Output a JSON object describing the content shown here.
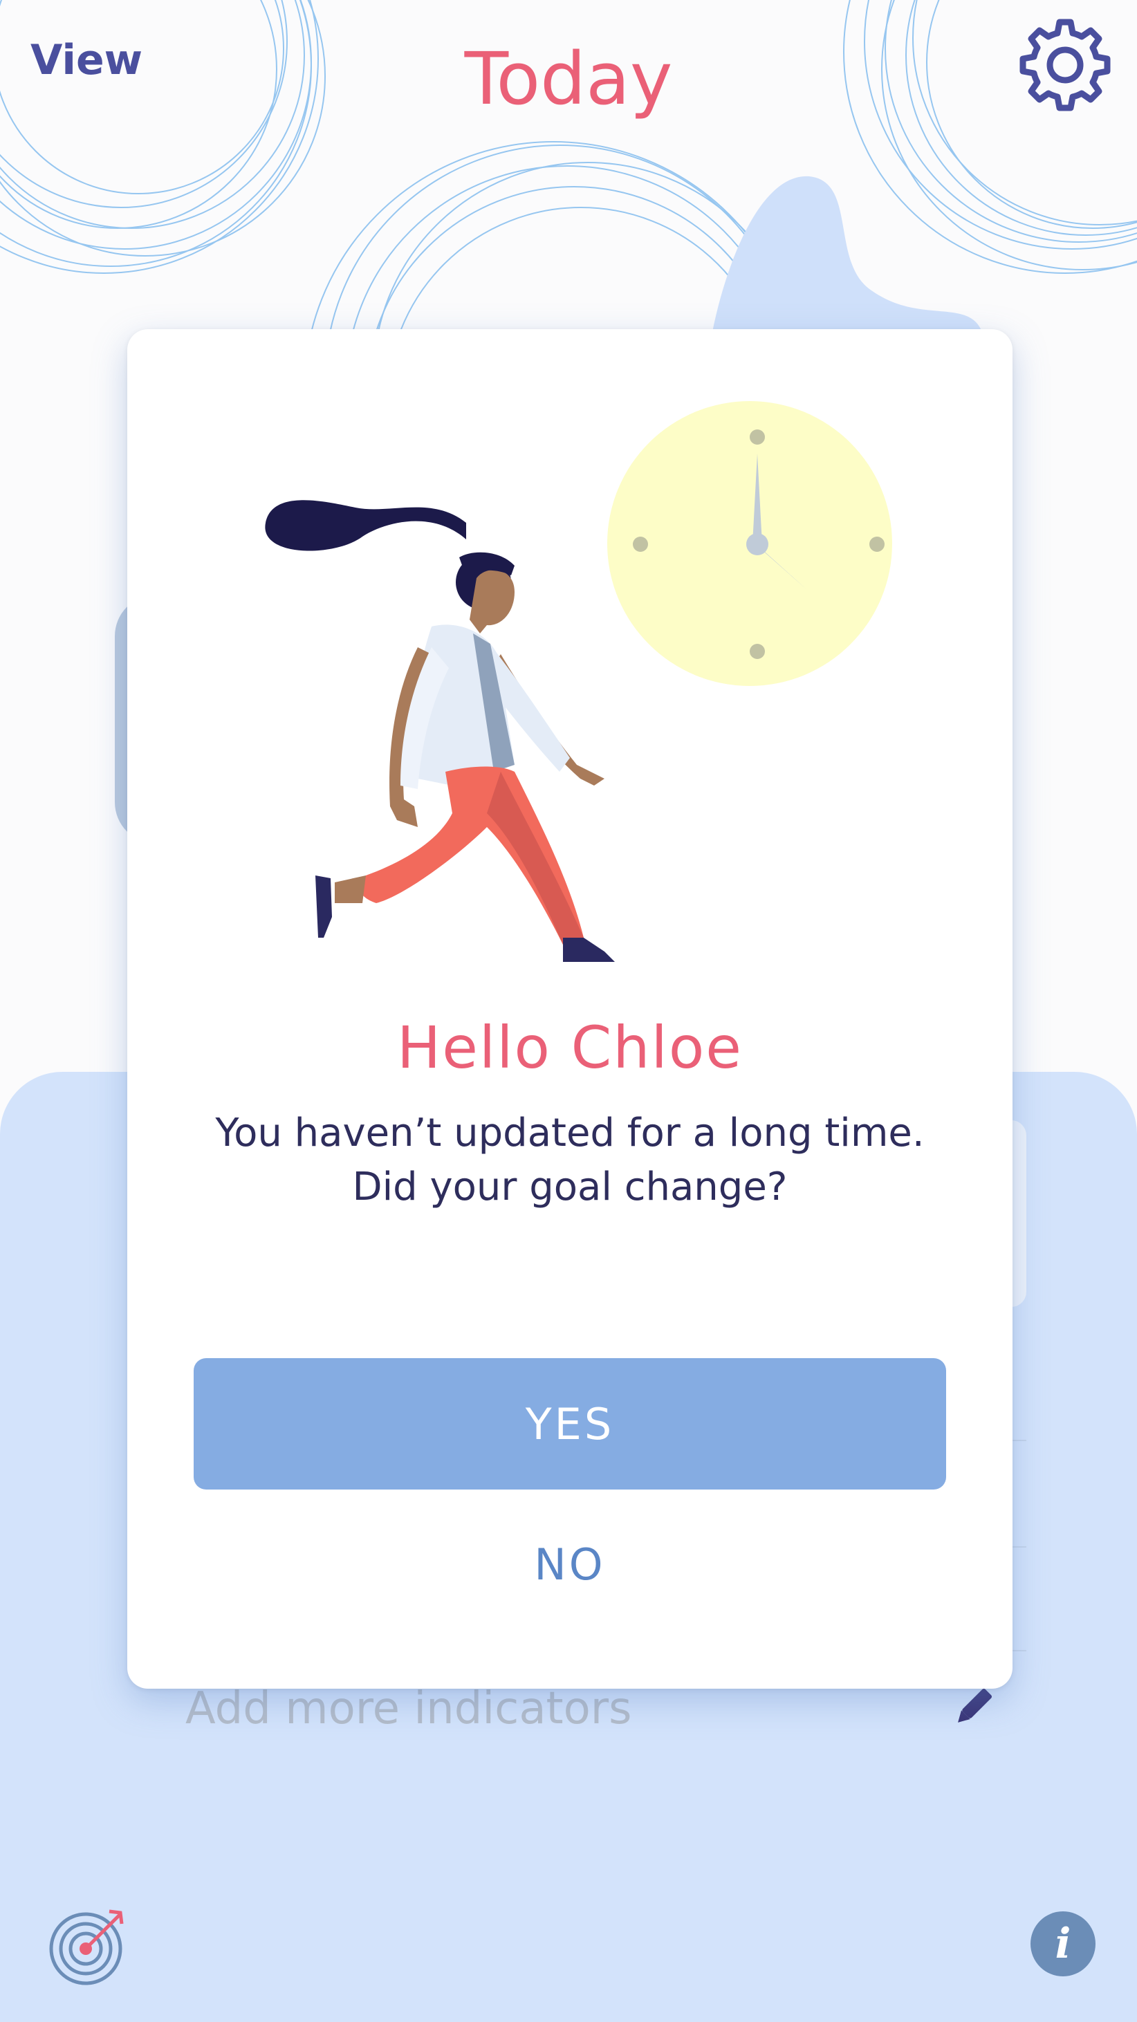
{
  "header": {
    "view_label": "View",
    "title": "Today",
    "settings_icon": "gear-icon"
  },
  "background": {
    "add_indicators_label": "Add more indicators",
    "edit_icon": "pencil-icon",
    "goals_icon": "target-icon",
    "info_icon": "info-icon",
    "info_glyph": "i"
  },
  "dialog": {
    "title": "Hello Chloe",
    "message_line1": "You haven’t updated for a long time.",
    "message_line2": "Did your goal change?",
    "yes_label": "YES",
    "no_label": "NO",
    "illustration": "woman-walking-with-clock"
  },
  "colors": {
    "accent_pink": "#ea6077",
    "nav_indigo": "#4a4f9e",
    "button_blue": "#85ace2",
    "link_blue": "#5a86c6",
    "panel_blue": "#d3e3fb"
  }
}
